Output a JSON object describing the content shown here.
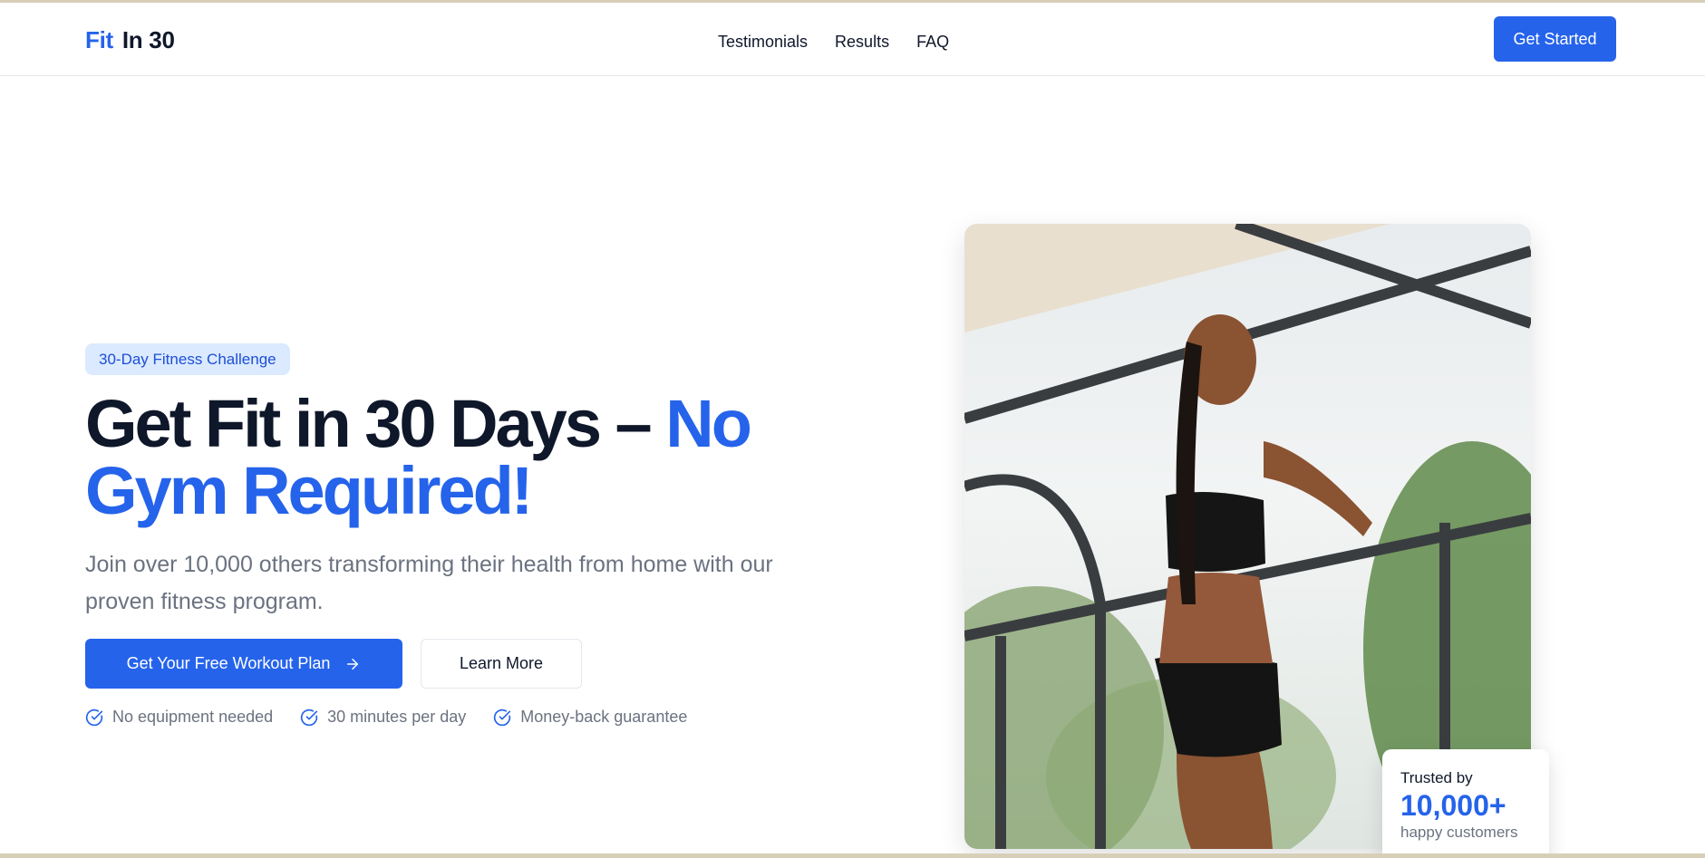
{
  "nav": {
    "logo_part1": "Fit",
    "logo_part2": "In 30",
    "links": [
      "Testimonials",
      "Results",
      "FAQ"
    ],
    "cta": "Get Started"
  },
  "hero": {
    "badge": "30-Day Fitness Challenge",
    "headline_main": "Get Fit in 30 Days – ",
    "headline_accent": "No Gym Required!",
    "subtext": "Join over 10,000 others transforming their health from home with our proven fitness program.",
    "primary_button": "Get Your Free Workout Plan",
    "secondary_button": "Learn More",
    "features": [
      "No equipment needed",
      "30 minutes per day",
      "Money-back guarantee"
    ]
  },
  "trust_card": {
    "label": "Trusted by",
    "count": "10,000+",
    "sub": "happy customers"
  },
  "colors": {
    "brand": "#2563eb",
    "badge_bg": "#dbeafe",
    "text": "#0f172a",
    "muted": "#6b7280"
  },
  "icons": {
    "check": "circle-check-icon",
    "arrow": "arrow-right-icon"
  }
}
